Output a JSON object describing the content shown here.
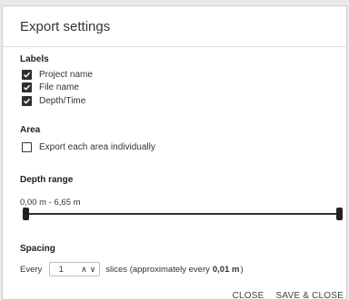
{
  "dialog": {
    "title": "Export settings"
  },
  "labels": {
    "heading": "Labels",
    "options": [
      {
        "label": "Project name",
        "checked": true
      },
      {
        "label": "File name",
        "checked": true
      },
      {
        "label": "Depth/Time",
        "checked": true
      }
    ]
  },
  "area": {
    "heading": "Area",
    "option": {
      "label": "Export each area individually",
      "checked": false
    }
  },
  "depth_range": {
    "heading": "Depth range",
    "value_text": "0,00 m - 6,65 m",
    "min_fraction": 0.0,
    "max_fraction": 1.0
  },
  "spacing": {
    "heading": "Spacing",
    "prefix": "Every",
    "stepper_value": "1",
    "suffix": "slices (approximately every",
    "approx_value": "0,01 m",
    "close_paren": ")"
  },
  "actions": {
    "close": "CLOSE",
    "save_close": "SAVE & CLOSE"
  },
  "colors": {
    "checkbox_fill": "#2f2f2f",
    "text": "#333333",
    "divider": "#dedede"
  }
}
